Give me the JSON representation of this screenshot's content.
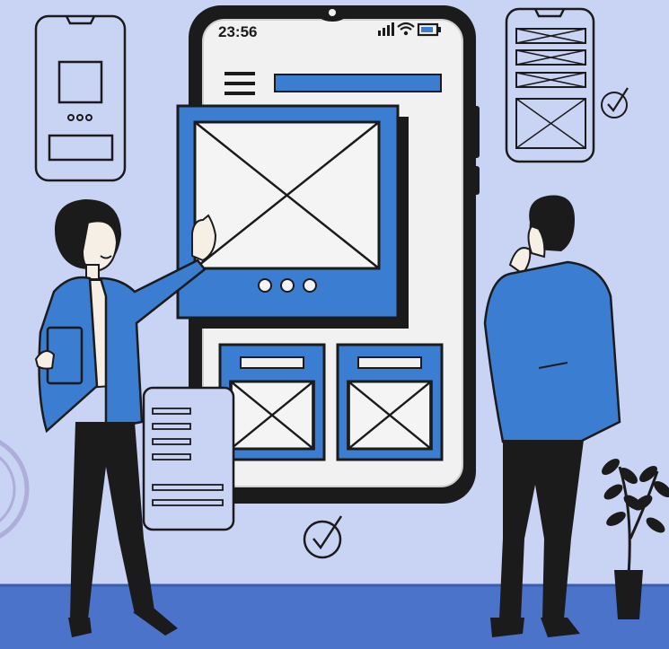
{
  "phone": {
    "status_time": "23:56",
    "status_icons": [
      "signal-bars-icon",
      "wifi-icon",
      "battery-icon"
    ],
    "carousel_dots": 3
  },
  "icons": {
    "menu": "hamburger-menu-icon",
    "image_placeholder": "image-placeholder-icon",
    "checkmark": "check-circle-icon"
  },
  "colors": {
    "background": "#c9d3f4",
    "floor": "#4a73c9",
    "accent_blue": "#3b7dd0",
    "outline": "#1b1b1b",
    "screen": "#f1f1f1"
  }
}
